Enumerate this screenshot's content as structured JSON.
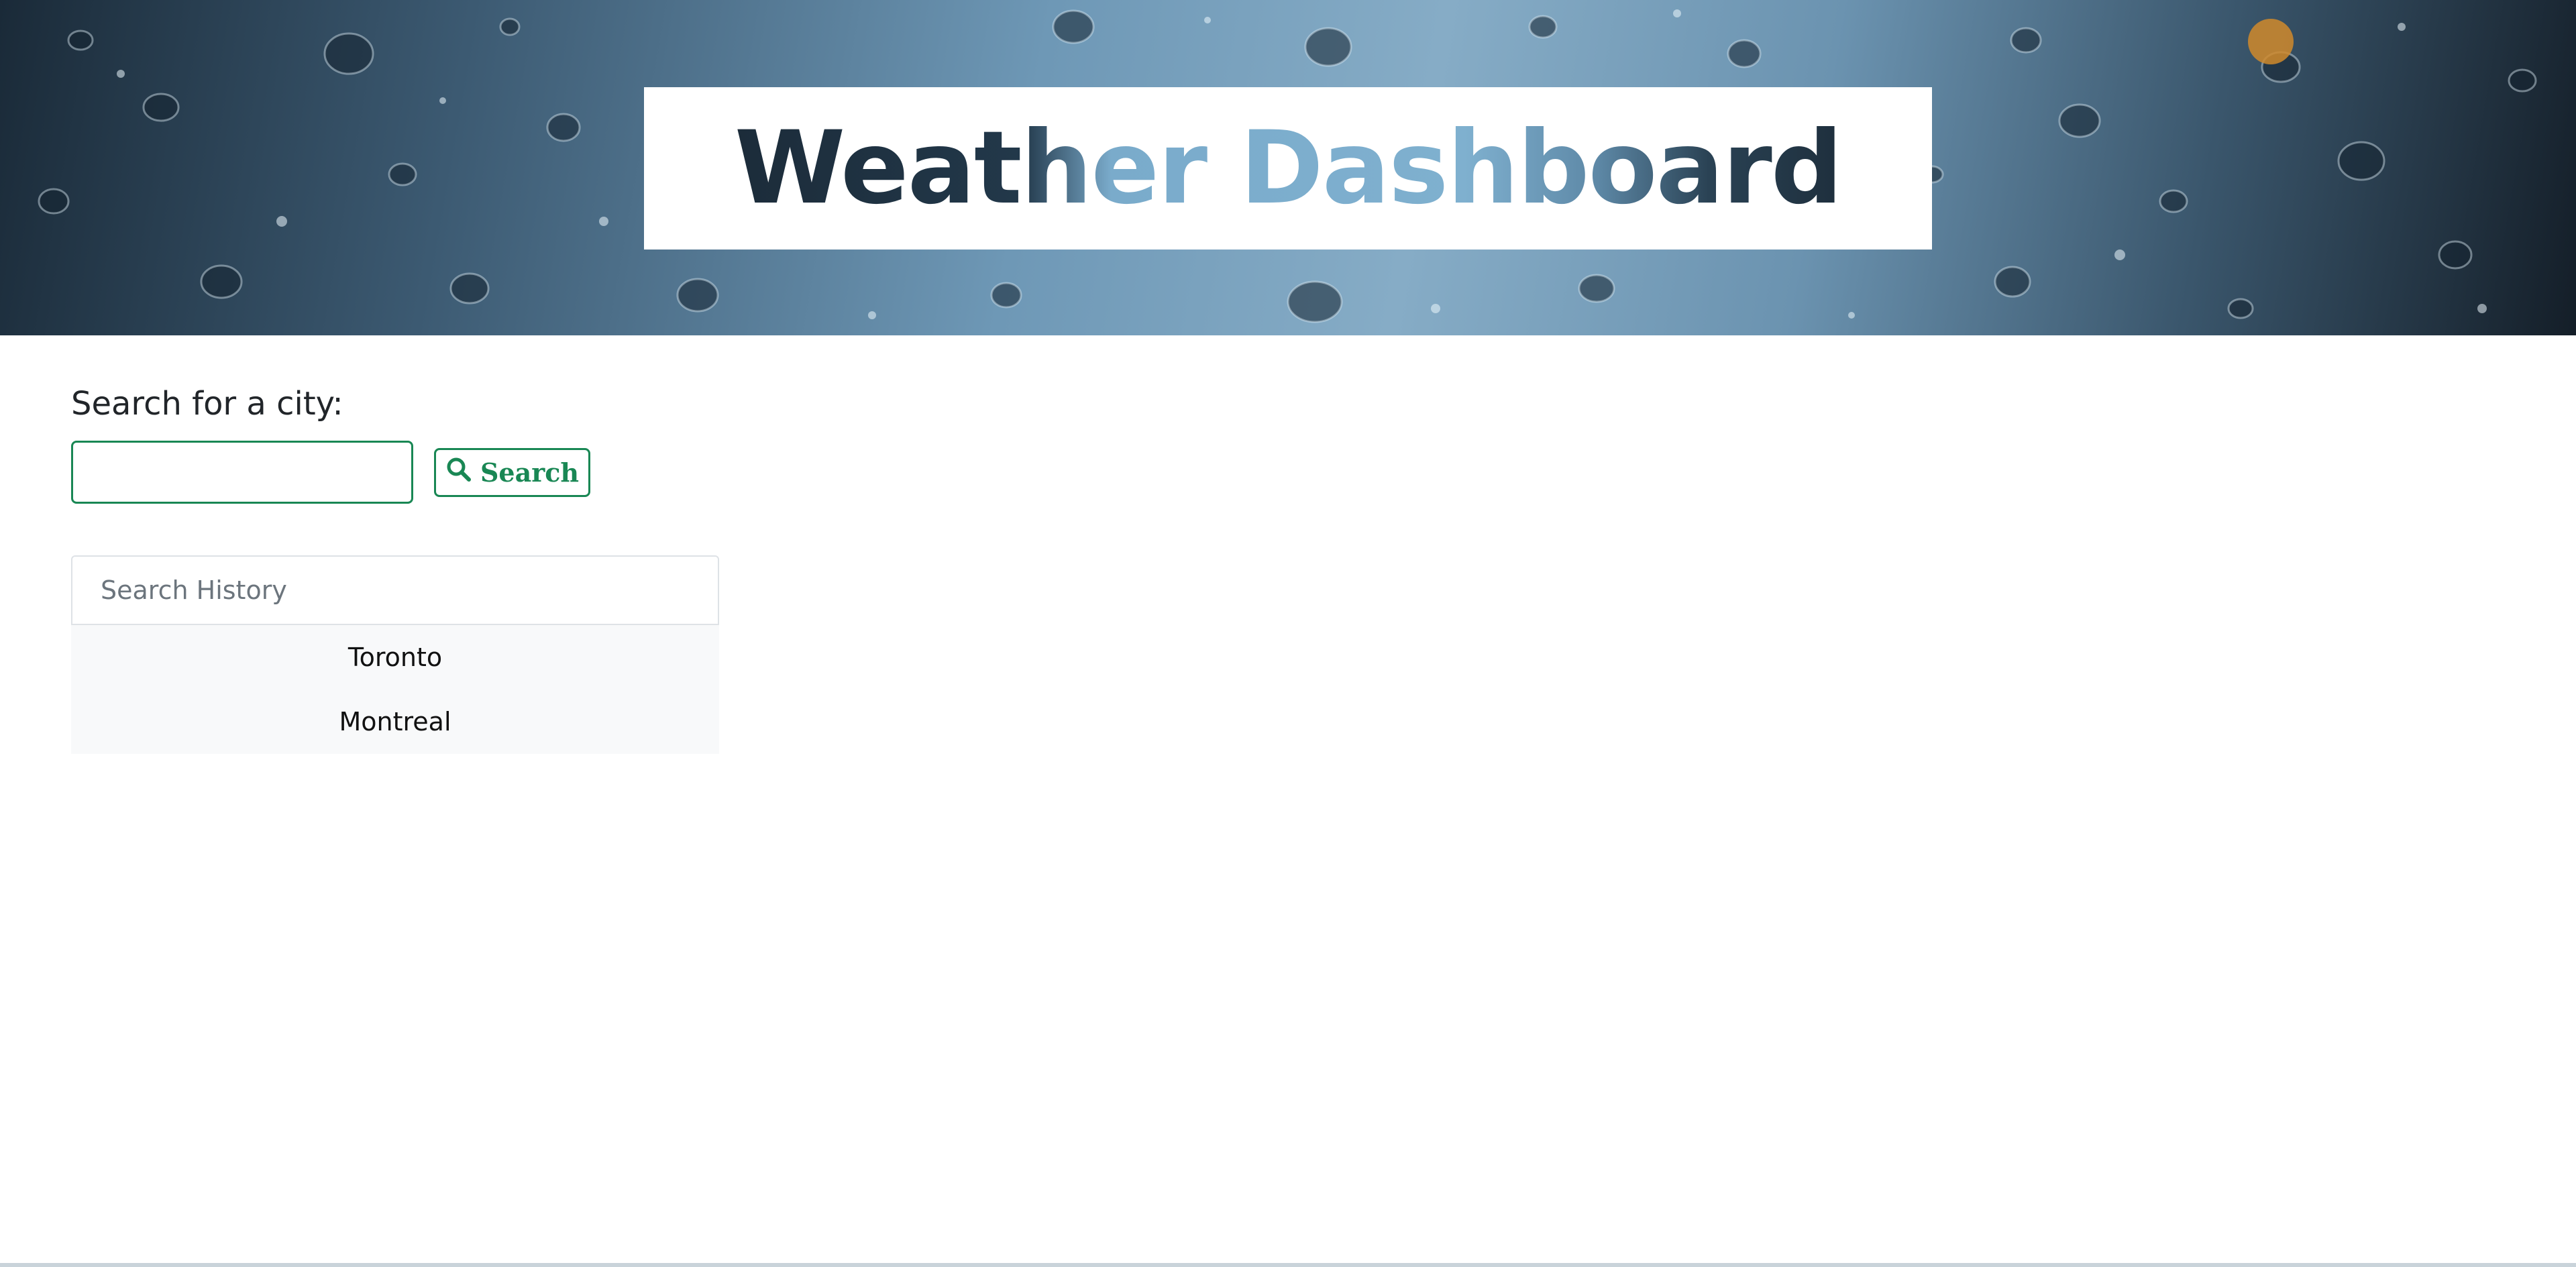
{
  "header": {
    "title": "Weather Dashboard"
  },
  "search": {
    "label": "Search for a city:",
    "input_value": "",
    "input_placeholder": "",
    "button_label": "Search",
    "button_icon": "search-icon"
  },
  "history": {
    "header": "Search History",
    "items": [
      {
        "label": "Toronto"
      },
      {
        "label": "Montreal"
      }
    ]
  },
  "colors": {
    "accent": "#198754",
    "history_item_bg": "#f8f9fa",
    "muted_text": "#6c757d"
  }
}
